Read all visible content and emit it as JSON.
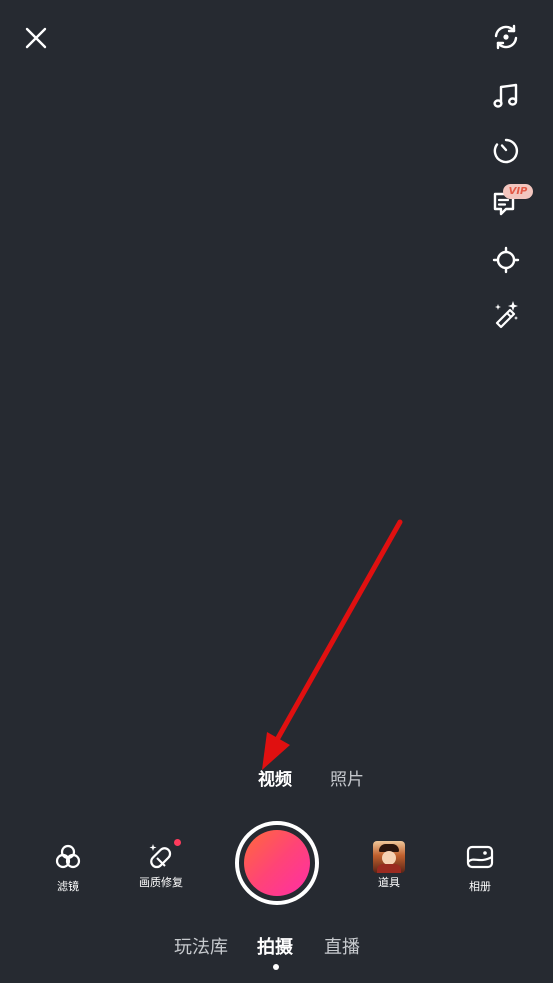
{
  "colors": {
    "background": "#262a31",
    "record_gradient_start": "#ff6a3a",
    "record_gradient_end": "#ff2ea6",
    "annotation_arrow": "#e01010",
    "vip_badge_bg": "#f3c6bf",
    "vip_badge_text": "#e35a47"
  },
  "top_bar": {
    "close_icon": "close-icon"
  },
  "right_tools": {
    "flip_icon": "flip-camera-icon",
    "music_icon": "music-note-icon",
    "timer_icon": "timer-icon",
    "subtitle_icon": "subtitle-icon",
    "vip_badge": "VIP",
    "beauty_icon": "beauty-icon",
    "magic_icon": "magic-wand-icon"
  },
  "capture_modes": {
    "video": "视频",
    "photo": "照片",
    "selected": "视频"
  },
  "bottom_tools": {
    "filter": "滤镜",
    "quality_repair": "画质修复",
    "props": "道具",
    "album": "相册"
  },
  "bottom_tabs": {
    "gameplay": "玩法库",
    "shoot": "拍摄",
    "live": "直播",
    "selected": "拍摄"
  }
}
